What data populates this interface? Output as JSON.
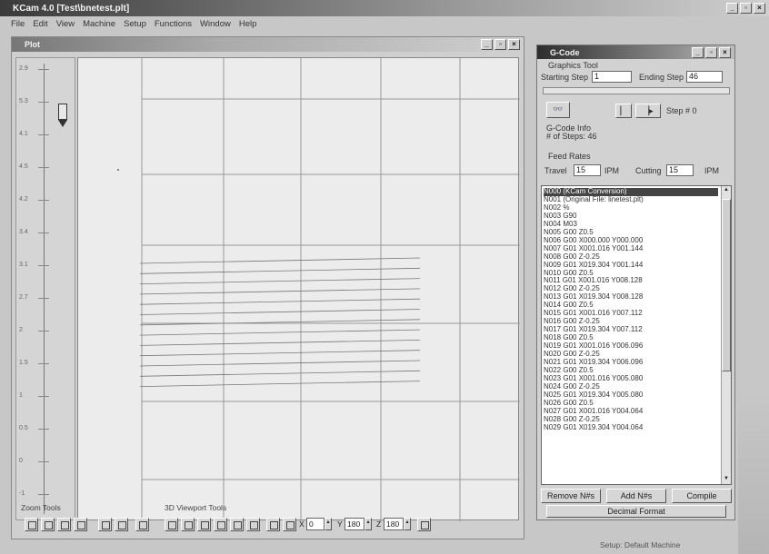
{
  "app": {
    "title": "KCam 4.0 [Test\\bnetest.plt]",
    "menu": [
      "File",
      "Edit",
      "View",
      "Machine",
      "Setup",
      "Functions",
      "Window",
      "Help"
    ]
  },
  "plot_window": {
    "title": "Plot",
    "zoom_label": "Zoom Tools",
    "viewport_label": "3D Viewport Tools",
    "zoom_ticks": [
      "2.9",
      "5.3",
      "4.1",
      "4.5",
      "4.2",
      "3.4",
      "3.1",
      "2.7",
      "2",
      "1.5",
      "1",
      "0.5",
      "0",
      "-1"
    ],
    "spin_x_label": "X",
    "spin_x_value": "0",
    "spin_y_label": "Y",
    "spin_y_value": "180",
    "spin_z_label": "Z",
    "spin_z_value": "180"
  },
  "gcode_window": {
    "title": "G-Code",
    "graphics_tool_label": "Graphics Tool",
    "starting_step_label": "Starting Step",
    "starting_step_value": "1",
    "ending_step_label": "Ending Step",
    "ending_step_value": "46",
    "step_text": "Step # 0",
    "gcode_info_label": "G-Code Info",
    "num_steps_text": "# of Steps: 46",
    "feed_rates_label": "Feed Rates",
    "travel_label": "Travel",
    "travel_value": "15",
    "travel_unit": "IPM",
    "cutting_label": "Cutting",
    "cutting_value": "15",
    "cutting_unit": "IPM",
    "lines": [
      "N000 (KCam Conversion)",
      "N001 (Original File: linetest.plt)",
      "N002 %",
      "N003 G90",
      "N004 M03",
      "N005 G00 Z0.5",
      "N006 G00 X000.000 Y000.000",
      "N007 G01 X001.016 Y001.144",
      "N008 G00 Z-0.25",
      "N009 G01 X019.304 Y001.144",
      "N010 G00 Z0.5",
      "N011 G01 X001.016 Y008.128",
      "N012 G00 Z-0.25",
      "N013 G01 X019.304 Y008.128",
      "N014 G00 Z0.5",
      "N015 G01 X001.016 Y007.112",
      "N016 G00 Z-0.25",
      "N017 G01 X019.304 Y007.112",
      "N018 G00 Z0.5",
      "N019 G01 X001.016 Y006.096",
      "N020 G00 Z-0.25",
      "N021 G01 X019.304 Y006.096",
      "N022 G00 Z0.5",
      "N023 G01 X001.016 Y005.080",
      "N024 G00 Z-0.25",
      "N025 G01 X019.304 Y005.080",
      "N026 G00 Z0.5",
      "N027 G01 X001.016 Y004.064",
      "N028 G00 Z-0.25",
      "N029 G01 X019.304 Y004.064"
    ],
    "remove_nos_label": "Remove N#s",
    "add_nos_label": "Add N#s",
    "compile_label": "Compile",
    "decimal_format_label": "Decimal Format"
  },
  "status": {
    "right_text": "Setup: Default Machine"
  }
}
